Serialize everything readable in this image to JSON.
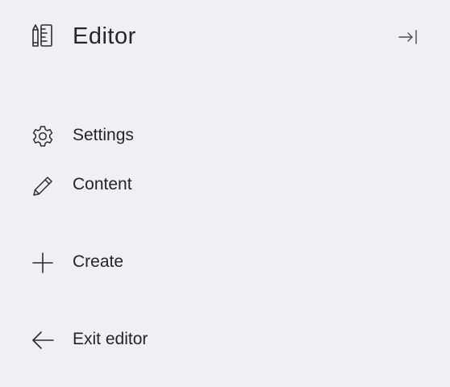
{
  "header": {
    "title": "Editor",
    "app_icon": "pencil-ruler-icon",
    "collapse_icon": "collapse-right-icon"
  },
  "nav": {
    "items": [
      {
        "label": "Settings",
        "icon": "gear-icon"
      },
      {
        "label": "Content",
        "icon": "pencil-icon"
      },
      {
        "label": "Create",
        "icon": "plus-icon"
      },
      {
        "label": "Exit editor",
        "icon": "arrow-left-icon"
      }
    ]
  },
  "colors": {
    "background": "#eff0f4",
    "text": "#232529",
    "icon": "#2a2c30"
  }
}
